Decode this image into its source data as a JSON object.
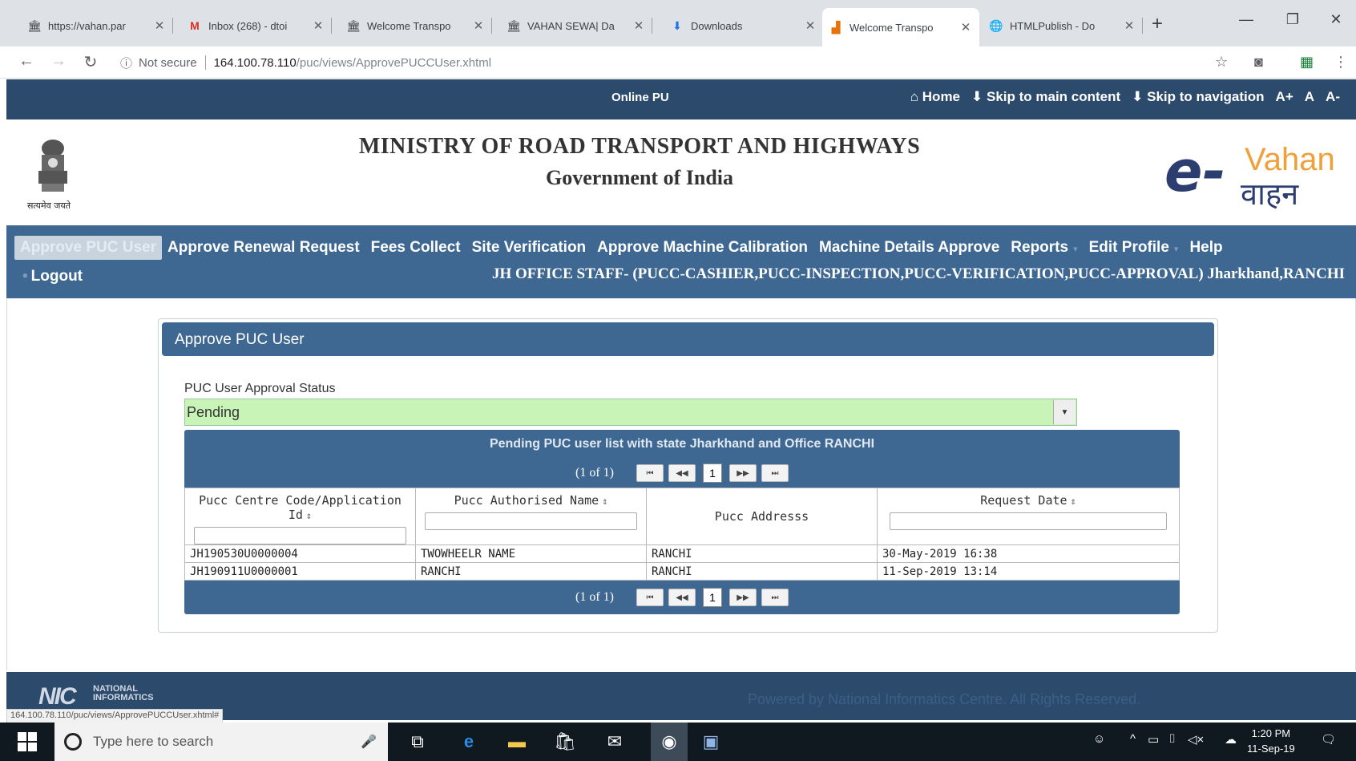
{
  "browser": {
    "tabs": [
      {
        "title": "https://vahan.par",
        "icon": "page-icon"
      },
      {
        "title": "Inbox (268) - dtoi",
        "icon": "gmail-icon"
      },
      {
        "title": "Welcome Transpo",
        "icon": "page-icon"
      },
      {
        "title": "VAHAN SEWA| Da",
        "icon": "page-icon"
      },
      {
        "title": "Downloads",
        "icon": "download-icon"
      },
      {
        "title": "Welcome Transpo",
        "icon": "chart-icon",
        "active": true
      },
      {
        "title": "HTMLPublish - Do",
        "icon": "globe-icon"
      }
    ],
    "security_label": "Not secure",
    "url_host": "164.100.78.110",
    "url_path": "/puc/views/ApprovePUCCUser.xhtml",
    "status_url": "164.100.78.110/puc/views/ApprovePUCCUser.xhtml#"
  },
  "topstrip": {
    "title": "Online PU",
    "home": "Home",
    "skip_main": "Skip to main content",
    "skip_nav": "Skip to navigation",
    "font_up": "A+",
    "font_normal": "A",
    "font_down": "A-"
  },
  "header": {
    "emblem_caption": "सत्यमेव जयते",
    "title_line1": "MINISTRY OF ROAD TRANSPORT AND HIGHWAYS",
    "title_line2": "Government of India",
    "logo_e": "e-",
    "logo_vahan_en": "Vahan",
    "logo_vahan_hi": "वाहन"
  },
  "menu": {
    "items": [
      {
        "label": "Approve PUC User",
        "active": true
      },
      {
        "label": "Approve Renewal Request"
      },
      {
        "label": "Fees Collect"
      },
      {
        "label": "Site Verification"
      },
      {
        "label": "Approve Machine Calibration"
      },
      {
        "label": "Machine Details Approve"
      },
      {
        "label": "Reports"
      },
      {
        "label": "Edit Profile"
      },
      {
        "label": "Help"
      }
    ],
    "logout": "Logout",
    "user_info": "JH OFFICE STAFF- (PUCC-CASHIER,PUCC-INSPECTION,PUCC-VERIFICATION,PUCC-APPROVAL) Jharkhand,RANCHI"
  },
  "panel": {
    "title": "Approve PUC User",
    "status_label": "PUC User Approval Status",
    "status_value": "Pending",
    "table_caption": "Pending PUC user list with state Jharkhand and Office RANCHI",
    "page_report": "(1 of 1)",
    "current_page": "1",
    "columns": [
      "Pucc Centre Code/Application Id",
      "Pucc Authorised Name",
      "Pucc Addresss",
      "Request Date"
    ],
    "rows": [
      [
        "JH190530U0000004",
        "TWOWHEELR NAME",
        "RANCHI",
        "30-May-2019 16:38"
      ],
      [
        "JH190911U0000001",
        "RANCHI",
        "RANCHI",
        "11-Sep-2019 13:14"
      ]
    ]
  },
  "footer": {
    "nic_logo": "NIC",
    "nic_line1": "NATIONAL",
    "nic_line2": "INFORMATICS",
    "powered": "Powered by National Informatics Centre. All Rights Reserved."
  },
  "taskbar": {
    "search_placeholder": "Type here to search",
    "time": "1:20 PM",
    "date": "11-Sep-19"
  },
  "colors": {
    "nav_dark": "#2c4a6b",
    "nav_blue": "#3e6891",
    "select_green": "#c8f4b8"
  }
}
